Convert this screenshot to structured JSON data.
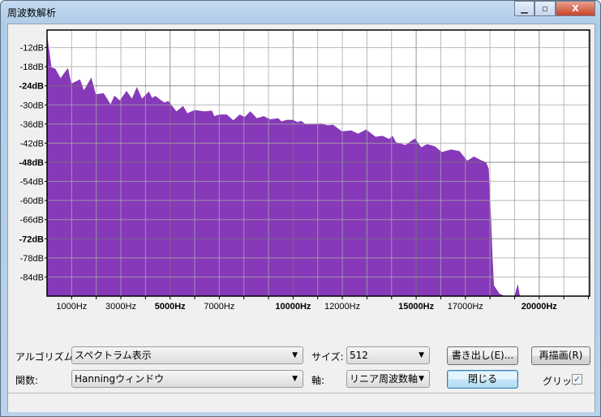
{
  "window": {
    "title": "周波数解析",
    "minimize": "▁",
    "maximize": "▫",
    "close": "X"
  },
  "controls": {
    "algorithm_label": "アルゴリズム:",
    "algorithm_value": "スペクトラム表示",
    "size_label": "サイズ:",
    "size_value": "512",
    "function_label": "関数:",
    "function_value": "Hanningウィンドウ",
    "axis_label": "軸:",
    "axis_value": "リニア周波数軸",
    "export_button": "書き出し(E)...",
    "replot_button": "再描画(R)",
    "close_button": "閉じる",
    "grid_label": "グリッド",
    "grid_checked": true,
    "grid_check": "✓"
  },
  "colors": {
    "fill": "#8639b8",
    "grid": "#a8a8a8",
    "grid_major": "#777777"
  },
  "chart_data": {
    "type": "area",
    "xlabel": "",
    "ylabel": "",
    "title": "",
    "xlim": [
      0,
      22050
    ],
    "ylim": [
      -90,
      -6.5
    ],
    "grid": true,
    "y_ticks": [
      {
        "v": -12,
        "label": "-12dB",
        "bold": false
      },
      {
        "v": -18,
        "label": "-18dB",
        "bold": false
      },
      {
        "v": -24,
        "label": "-24dB",
        "bold": true
      },
      {
        "v": -30,
        "label": "-30dB",
        "bold": false
      },
      {
        "v": -36,
        "label": "-36dB",
        "bold": false
      },
      {
        "v": -42,
        "label": "-42dB",
        "bold": false
      },
      {
        "v": -48,
        "label": "-48dB",
        "bold": true
      },
      {
        "v": -54,
        "label": "-54dB",
        "bold": false
      },
      {
        "v": -60,
        "label": "-60dB",
        "bold": false
      },
      {
        "v": -66,
        "label": "-66dB",
        "bold": false
      },
      {
        "v": -72,
        "label": "-72dB",
        "bold": true
      },
      {
        "v": -78,
        "label": "-78dB",
        "bold": false
      },
      {
        "v": -84,
        "label": "-84dB",
        "bold": false
      }
    ],
    "x_ticks": [
      {
        "v": 1000,
        "label": "1000Hz",
        "bold": false
      },
      {
        "v": 3000,
        "label": "3000Hz",
        "bold": false
      },
      {
        "v": 5000,
        "label": "5000Hz",
        "bold": true
      },
      {
        "v": 7000,
        "label": "7000Hz",
        "bold": false
      },
      {
        "v": 10000,
        "label": "10000Hz",
        "bold": true
      },
      {
        "v": 12000,
        "label": "12000Hz",
        "bold": false
      },
      {
        "v": 15000,
        "label": "15000Hz",
        "bold": true
      },
      {
        "v": 17000,
        "label": "17000Hz",
        "bold": false
      },
      {
        "v": 20000,
        "label": "20000Hz",
        "bold": true
      }
    ],
    "x": [
      0,
      100,
      180,
      330,
      550,
      850,
      990,
      1340,
      1500,
      1800,
      1980,
      2300,
      2580,
      2740,
      2960,
      3230,
      3450,
      3650,
      3860,
      4140,
      4270,
      4400,
      4760,
      4930,
      5260,
      5530,
      5700,
      6000,
      6400,
      6700,
      6800,
      7000,
      7300,
      7570,
      7830,
      8030,
      8260,
      8530,
      8800,
      9070,
      9400,
      9530,
      9730,
      10000,
      10170,
      10330,
      10500,
      11130,
      11400,
      11620,
      11980,
      12360,
      12640,
      12970,
      13350,
      13630,
      13900,
      14040,
      14180,
      14560,
      14950,
      15210,
      15440,
      15760,
      16040,
      16420,
      16760,
      17080,
      17350,
      17620,
      17840,
      17950,
      17980,
      18040,
      18100,
      18160,
      18380,
      18600,
      18970,
      19020,
      19130,
      19220,
      22050
    ],
    "y": [
      -8,
      -13.4,
      -18.2,
      -18.6,
      -21.6,
      -18.4,
      -23.3,
      -22,
      -25.4,
      -21.4,
      -26.7,
      -26.3,
      -29.8,
      -27.1,
      -28.6,
      -25.6,
      -28,
      -24.4,
      -28,
      -25.8,
      -27.8,
      -27.2,
      -29.2,
      -28.8,
      -32,
      -30.3,
      -32.6,
      -31.6,
      -32,
      -31.8,
      -33.5,
      -33,
      -33,
      -34.8,
      -33,
      -33.8,
      -32,
      -34.2,
      -33.5,
      -34.5,
      -34.2,
      -35.2,
      -34.7,
      -34.7,
      -35.4,
      -35,
      -36,
      -35.8,
      -36.4,
      -36.2,
      -38.3,
      -38,
      -39,
      -37.7,
      -40,
      -39.7,
      -40.7,
      -39.7,
      -41.7,
      -42.6,
      -40.5,
      -43.3,
      -42.3,
      -43,
      -44.8,
      -44,
      -44.5,
      -47.5,
      -46.2,
      -47.3,
      -48,
      -50,
      -55.2,
      -64.5,
      -77.3,
      -86.6,
      -89.2,
      -90,
      -90,
      -89.2,
      -86.2,
      -90,
      -90
    ]
  }
}
